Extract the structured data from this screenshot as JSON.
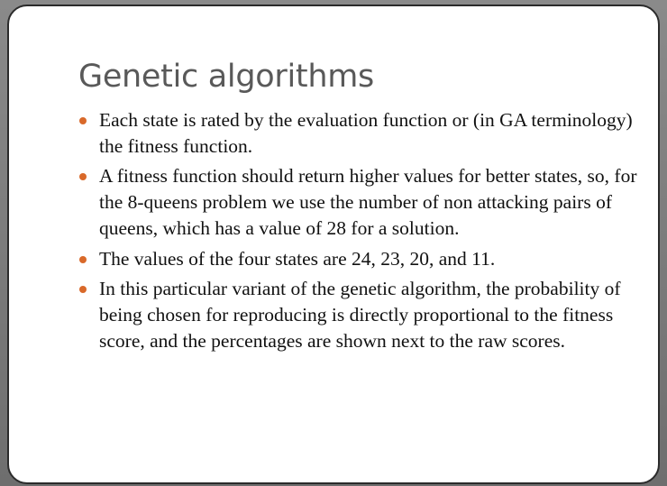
{
  "slide": {
    "title": "Genetic algorithms",
    "bullets": [
      "Each state is rated by the evaluation function or (in GA terminology) the fitness function.",
      "A fitness function should return higher values for better states, so, for the 8-queens problem we use the number of non attacking pairs of queens, which has a value of 28 for a solution.",
      "The values of the four states are 24, 23, 20, and 11.",
      "In this particular variant of the genetic algorithm, the probability of being chosen for reproducing is directly proportional to the fitness score, and the percentages are shown next to the raw scores."
    ]
  },
  "colors": {
    "bullet": "#d9692a",
    "title": "#595959",
    "body_text": "#111111"
  }
}
